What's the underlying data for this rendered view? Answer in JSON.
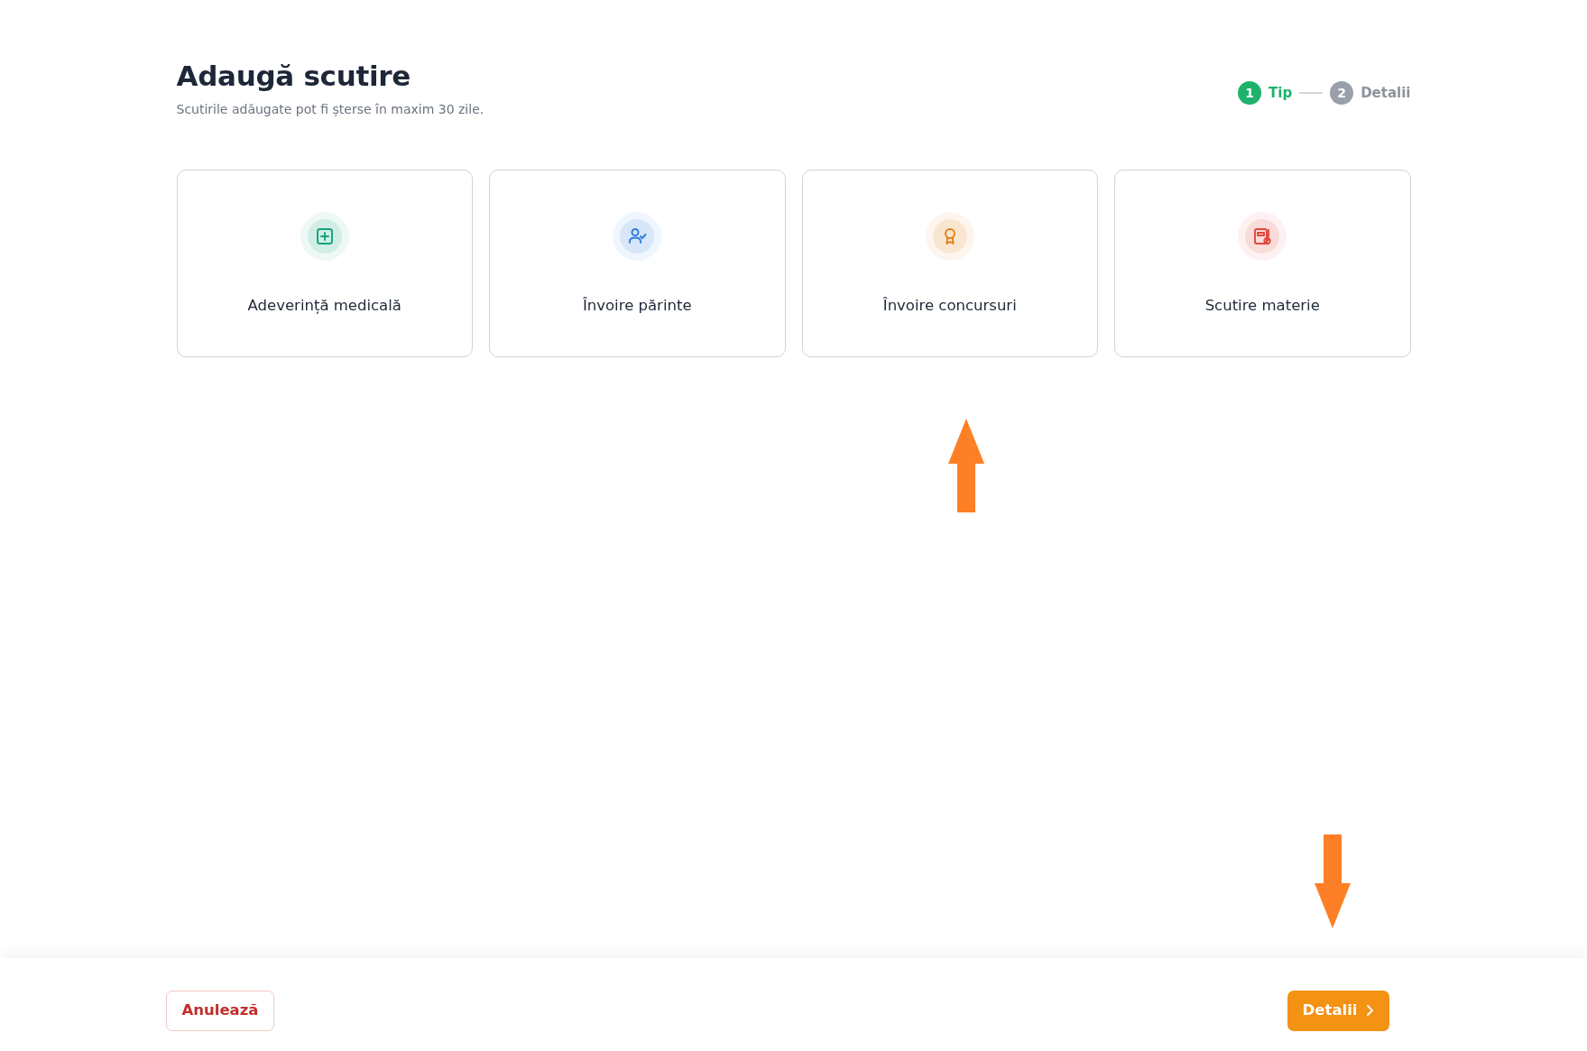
{
  "header": {
    "title": "Adaugă scutire",
    "subtitle": "Scutirile adăugate pot fi șterse în maxim 30 zile."
  },
  "steps": [
    {
      "number": "1",
      "label": "Tip",
      "selected": true
    },
    {
      "number": "2",
      "label": "Detalii",
      "selected": false
    }
  ],
  "options": [
    {
      "label": "Adeverință medicală",
      "kind": "medical",
      "color": "#12a37a"
    },
    {
      "label": "Învoire părinte",
      "kind": "parent",
      "color": "#2f7be0"
    },
    {
      "label": "Învoire concursuri",
      "kind": "award",
      "color": "#e07f12"
    },
    {
      "label": "Scutire materie",
      "kind": "subject",
      "color": "#e0463c"
    }
  ],
  "footer": {
    "cancel": "Anulează",
    "next": "Detalii"
  },
  "annotation_arrows": [
    {
      "kind": "up"
    },
    {
      "kind": "down"
    }
  ]
}
